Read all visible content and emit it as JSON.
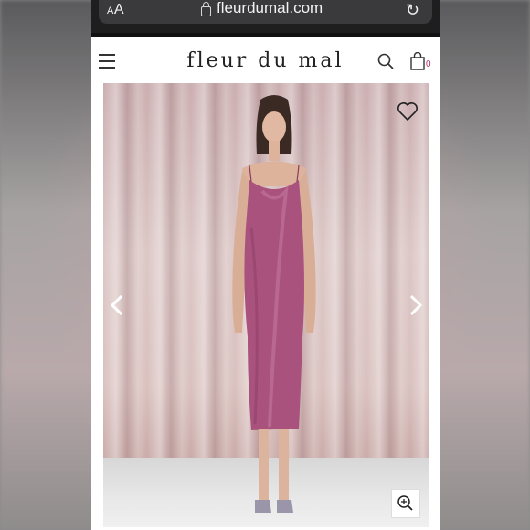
{
  "browser": {
    "text_size_label": "AA",
    "url": "fleurdumal.com",
    "lock_icon": "lock-icon",
    "reload_icon": "reload-icon"
  },
  "site": {
    "logo": "fleur du mal",
    "menu_icon": "hamburger-menu-icon",
    "search_icon": "search-icon",
    "bag_icon": "shopping-bag-icon",
    "bag_count": "0",
    "accent_color": "#b0306b"
  },
  "product_gallery": {
    "image_alt": "Model wearing a mauve satin cowl-neck slip midi dress in front of a blush velvet curtain",
    "dress_color": "#a9527e",
    "favorite_icon": "heart-icon",
    "prev_icon": "chevron-left-icon",
    "next_icon": "chevron-right-icon",
    "zoom_icon": "zoom-in-icon"
  }
}
